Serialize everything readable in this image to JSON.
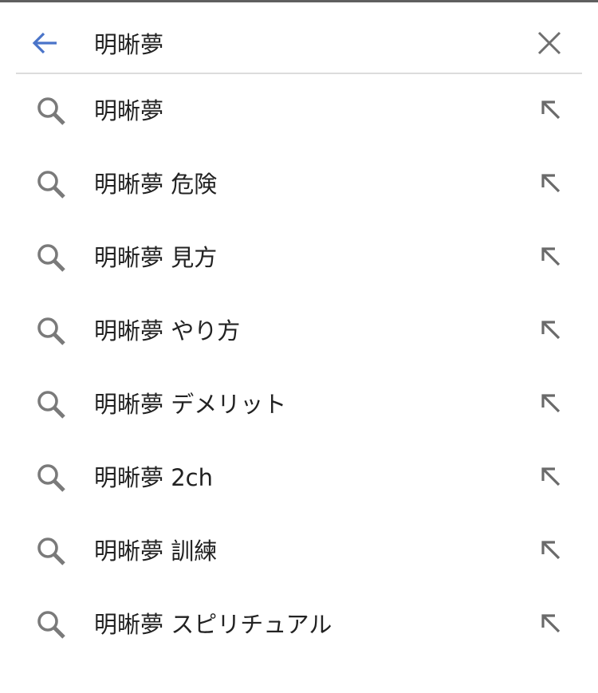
{
  "search": {
    "query": "明晰夢",
    "back_icon": "arrow-left-icon",
    "clear_icon": "close-icon"
  },
  "suggestions": [
    {
      "text": "明晰夢"
    },
    {
      "text": "明晰夢 危険"
    },
    {
      "text": "明晰夢 見方"
    },
    {
      "text": "明晰夢 やり方"
    },
    {
      "text": "明晰夢 デメリット"
    },
    {
      "text": "明晰夢 2ch"
    },
    {
      "text": "明晰夢 訓練"
    },
    {
      "text": "明晰夢 スピリチュアル"
    }
  ],
  "icons": {
    "suggestion": "search-icon",
    "fill": "arrow-up-left-icon"
  },
  "colors": {
    "accent": "#4a74c9",
    "icon_gray": "#7a7a7a",
    "text": "#222222",
    "divider": "#dcdcdc"
  }
}
